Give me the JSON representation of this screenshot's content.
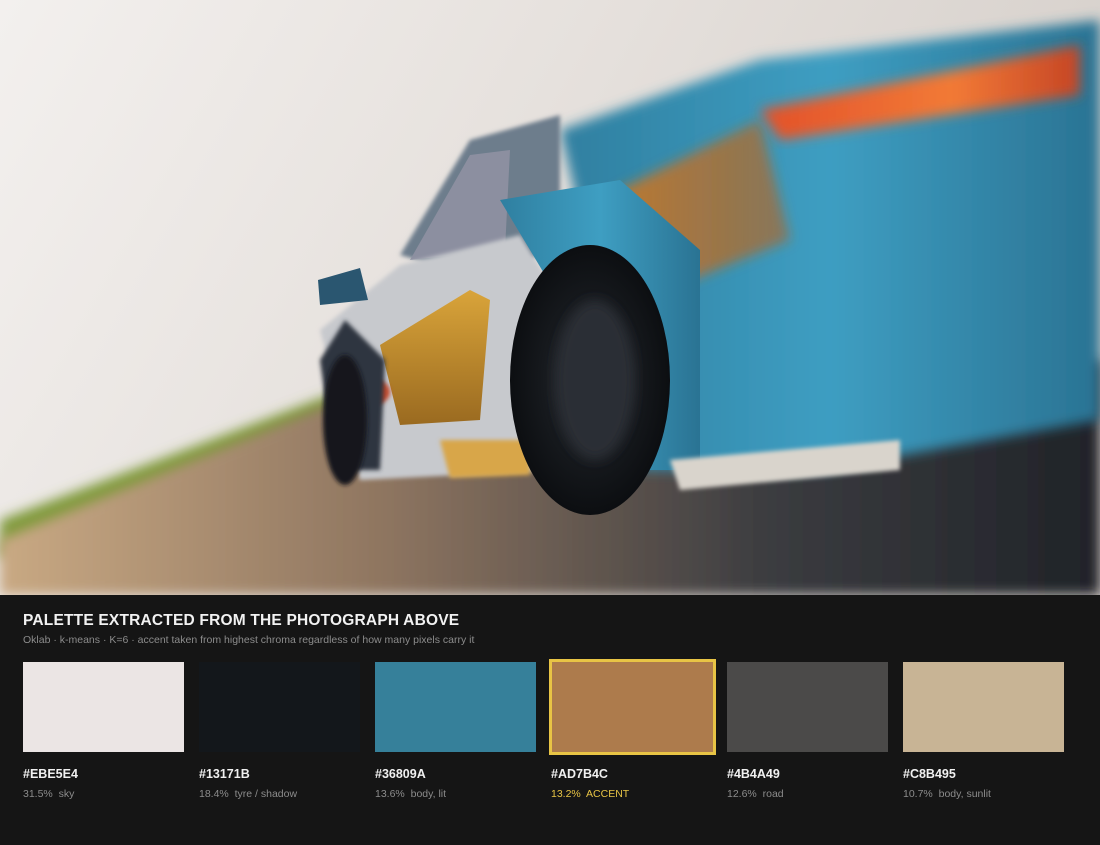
{
  "palette": {
    "title": "PALETTE EXTRACTED FROM THE PHOTOGRAPH ABOVE",
    "subtitle": "Oklab · k-means · K=6 · accent taken from highest chroma regardless of how many pixels carry it",
    "swatches": [
      {
        "hex": "#EBE5E4",
        "color": "#ebe5e4",
        "share": "31.5%",
        "label": "sky",
        "accent": false
      },
      {
        "hex": "#13171B",
        "color": "#13171b",
        "share": "18.4%",
        "label": "tyre / shadow",
        "accent": false
      },
      {
        "hex": "#36809A",
        "color": "#36809a",
        "share": "13.6%",
        "label": "body, lit",
        "accent": false
      },
      {
        "hex": "#AD7B4C",
        "color": "#ad7b4c",
        "share": "13.2%",
        "label": "ACCENT",
        "accent": true
      },
      {
        "hex": "#4B4A49",
        "color": "#4b4a49",
        "share": "12.6%",
        "label": "road",
        "accent": false
      },
      {
        "hex": "#C8B495",
        "color": "#c8b495",
        "share": "10.7%",
        "label": "body, sunlit",
        "accent": false
      }
    ],
    "accent_outline_color": "#e8c445"
  }
}
